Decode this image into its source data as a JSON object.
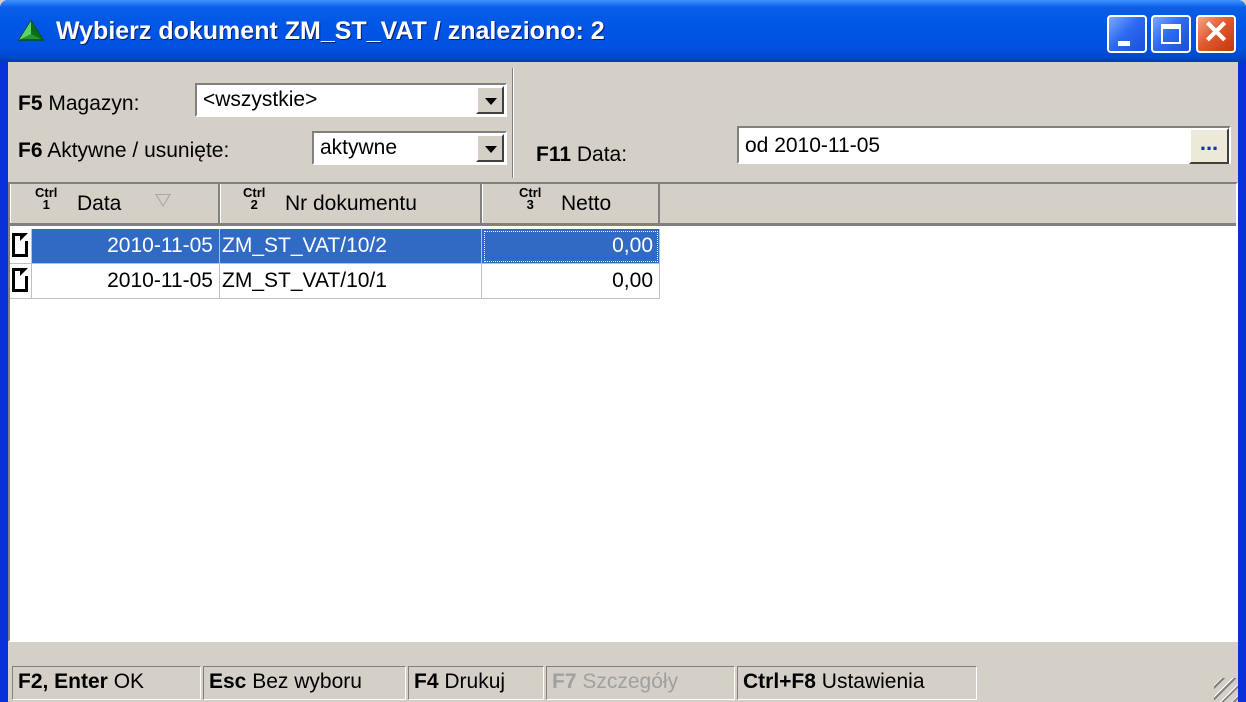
{
  "window": {
    "title": "Wybierz dokument ZM_ST_VAT / znaleziono: 2",
    "app_icon": "green-pyramid-icon",
    "controls": {
      "minimize": "minimize-icon",
      "maximize": "maximize-icon",
      "close_glyph": "✕"
    }
  },
  "filters": {
    "magazyn": {
      "key": "F5",
      "label": "Magazyn:",
      "value": "<wszystkie>"
    },
    "aktywne": {
      "key": "F6",
      "label": "Aktywne / usunięte:",
      "value": "aktywne"
    },
    "data": {
      "key": "F11",
      "label": "Data:",
      "value": "od 2010-11-05",
      "button_label": "..."
    }
  },
  "grid": {
    "columns": [
      {
        "ctrl_top": "Ctrl",
        "ctrl_num": "1",
        "label": "Data",
        "sorted": "descending"
      },
      {
        "ctrl_top": "Ctrl",
        "ctrl_num": "2",
        "label": "Nr dokumentu"
      },
      {
        "ctrl_top": "Ctrl",
        "ctrl_num": "3",
        "label": "Netto"
      }
    ],
    "rows": [
      {
        "date": "2010-11-05",
        "number": "ZM_ST_VAT/10/2",
        "netto": "0,00",
        "selected": true,
        "icon": "document-icon"
      },
      {
        "date": "2010-11-05",
        "number": "ZM_ST_VAT/10/1",
        "netto": "0,00",
        "selected": false,
        "icon": "document-icon"
      }
    ]
  },
  "statusbar": [
    {
      "key": "F2, Enter",
      "label": "OK",
      "enabled": true
    },
    {
      "key": "Esc",
      "label": "Bez wyboru",
      "enabled": true
    },
    {
      "key": "F4",
      "label": "Drukuj",
      "enabled": true
    },
    {
      "key": "F7",
      "label": "Szczegóły",
      "enabled": false
    },
    {
      "key": "Ctrl+F8",
      "label": "Ustawienia",
      "enabled": true
    }
  ],
  "colors": {
    "titlebar": "#0054e3",
    "selection": "#316ac5",
    "face": "#d4d0c8"
  }
}
